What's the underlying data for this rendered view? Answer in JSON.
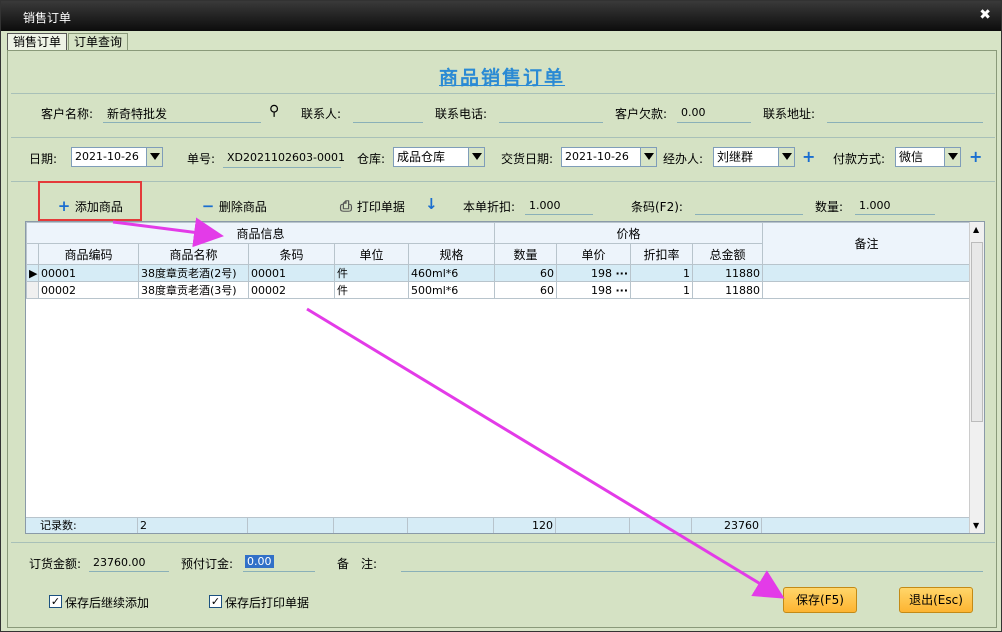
{
  "window": {
    "title": "销售订单",
    "close": "✖"
  },
  "tabs": [
    "销售订单",
    "订单查询"
  ],
  "heading": "商品销售订单",
  "customer": {
    "name_label": "客户名称:",
    "name_value": "新奇特批发",
    "contact_label": "联系人:",
    "phone_label": "联系电话:",
    "debt_label": "客户欠款:",
    "debt_value": "0.00",
    "address_label": "联系地址:"
  },
  "order": {
    "date_label": "日期:",
    "date_value": "2021-10-26",
    "number_label": "单号:",
    "number_value": "XD2021102603-0001",
    "warehouse_label": "仓库:",
    "warehouse_value": "成品仓库",
    "delivery_label": "交货日期:",
    "delivery_value": "2021-10-26",
    "handler_label": "经办人:",
    "handler_value": "刘继群",
    "payment_label": "付款方式:",
    "payment_value": "微信"
  },
  "toolbar": {
    "add": "添加商品",
    "delete": "删除商品",
    "print": "打印单据",
    "discount_label": "本单折扣:",
    "discount_value": "1.000",
    "barcode_label": "条码(F2):",
    "qty_label": "数量:",
    "qty_value": "1.000"
  },
  "grid": {
    "group_product": "商品信息",
    "group_price": "价格",
    "remark": "备注",
    "columns": [
      "商品编码",
      "商品名称",
      "条码",
      "单位",
      "规格",
      "数量",
      "单价",
      "折扣率",
      "总金额"
    ],
    "rows": [
      {
        "code": "00001",
        "name": "38度章贡老酒(2号)",
        "barcode": "00001",
        "unit": "件",
        "spec": "460ml*6",
        "qty": "60",
        "price": "198",
        "rate": "1",
        "total": "11880",
        "remark": ""
      },
      {
        "code": "00002",
        "name": "38度章贡老酒(3号)",
        "barcode": "00002",
        "unit": "件",
        "spec": "500ml*6",
        "qty": "60",
        "price": "198",
        "rate": "1",
        "total": "11880",
        "remark": ""
      }
    ],
    "footer": {
      "label": "记录数:",
      "count": "2",
      "qty": "120",
      "total": "23760"
    }
  },
  "bottom": {
    "amount_label": "订货金额:",
    "amount_value": "23760.00",
    "deposit_label": "预付订金:",
    "deposit_value": "0.00",
    "remark_label": "备　注:",
    "cb_continue": "保存后继续添加",
    "cb_print": "保存后打印单据",
    "save": "保存(F5)",
    "exit": "退出(Esc)"
  },
  "colors": {
    "annotation": "#e33be8",
    "heading": "#2a8ad4",
    "highlight": "#e43a3a"
  }
}
